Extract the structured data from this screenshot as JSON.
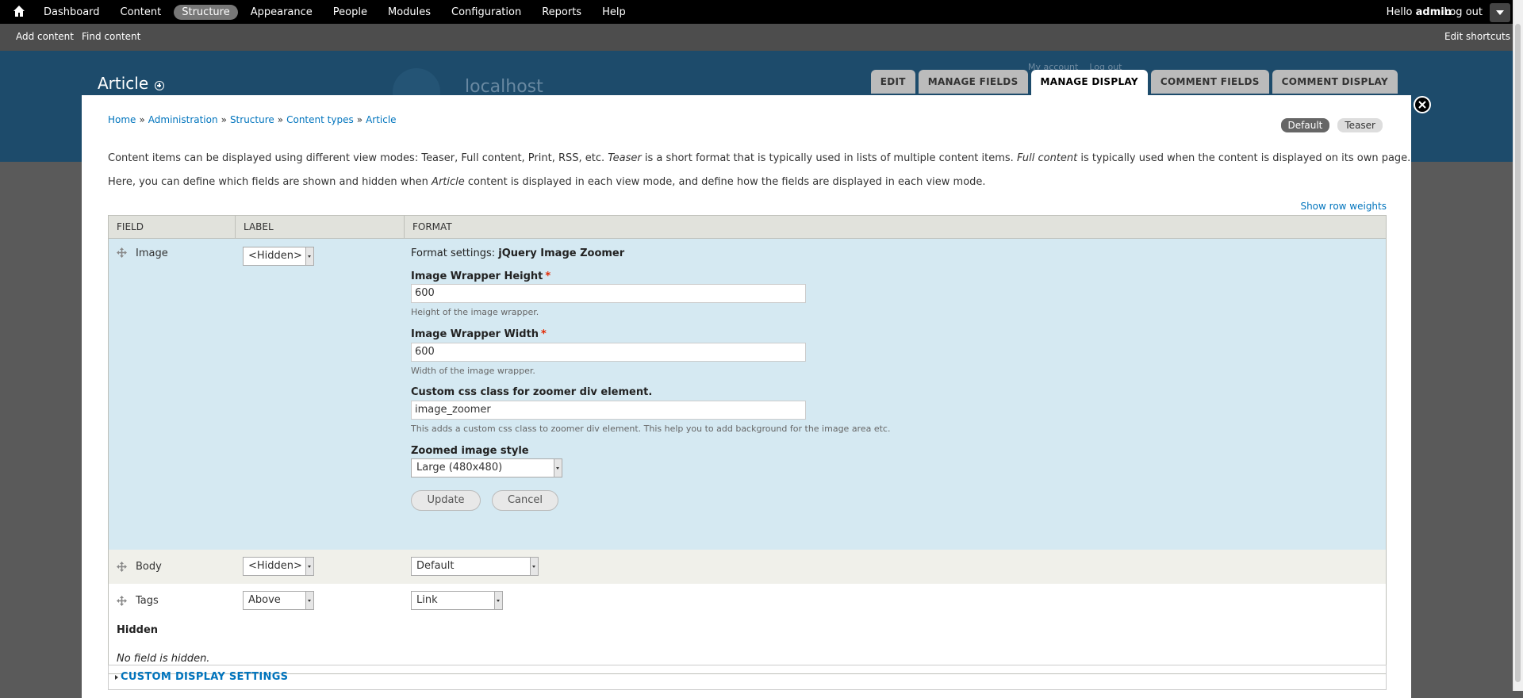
{
  "toolbar": {
    "menu": [
      "Dashboard",
      "Content",
      "Structure",
      "Appearance",
      "People",
      "Modules",
      "Configuration",
      "Reports",
      "Help"
    ],
    "active_item": "Structure",
    "hello": "Hello",
    "username": "admin",
    "logout": "Log out"
  },
  "shortcuts": {
    "add": "Add content",
    "find": "Find content",
    "edit": "Edit shortcuts"
  },
  "header": {
    "site_name": "localhost",
    "my_account": "My account",
    "log_out": "Log out"
  },
  "page": {
    "title": "Article"
  },
  "tabs": [
    "EDIT",
    "MANAGE FIELDS",
    "MANAGE DISPLAY",
    "COMMENT FIELDS",
    "COMMENT DISPLAY"
  ],
  "active_tab": "MANAGE DISPLAY",
  "breadcrumb": [
    "Home",
    "Administration",
    "Structure",
    "Content types",
    "Article"
  ],
  "view_modes": [
    "Default",
    "Teaser"
  ],
  "active_view_mode": "Default",
  "intro": {
    "line1_a": "Content items can be displayed using different view modes: Teaser, Full content, Print, RSS, etc. ",
    "line1_b": "Teaser",
    "line1_c": " is a short format that is typically used in lists of multiple content items. ",
    "line1_d": "Full content",
    "line1_e": " is typically used when the content is displayed on its own page.",
    "line2_a": "Here, you can define which fields are shown and hidden when ",
    "line2_b": "Article",
    "line2_c": " content is displayed in each view mode, and define how the fields are displayed in each view mode."
  },
  "show_row_weights": "Show row weights",
  "table": {
    "headers": {
      "field": "FIELD",
      "label": "LABEL",
      "format": "FORMAT"
    },
    "image_row": {
      "field": "Image",
      "label_select": "<Hidden>",
      "format_settings_prefix": "Format settings: ",
      "format_settings_name": "jQuery Image Zoomer",
      "height": {
        "label": "Image Wrapper Height",
        "required": "*",
        "value": "600",
        "help": "Height of the image wrapper."
      },
      "width": {
        "label": "Image Wrapper Width",
        "required": "*",
        "value": "600",
        "help": "Width of the image wrapper."
      },
      "css": {
        "label": "Custom css class for zoomer div element.",
        "value": "image_zoomer",
        "help": "This adds a custom css class to zoomer div element. This help you to add background for the image area etc."
      },
      "style": {
        "label": "Zoomed image style",
        "value": "Large (480x480)"
      },
      "update": "Update",
      "cancel": "Cancel"
    },
    "body_row": {
      "field": "Body",
      "label_select": "<Hidden>",
      "format_select": "Default"
    },
    "tags_row": {
      "field": "Tags",
      "label_select": "Above",
      "format_select": "Link"
    },
    "hidden_heading": "Hidden",
    "no_hidden": "No field is hidden."
  },
  "custom_display": "CUSTOM DISPLAY SETTINGS",
  "colors": {
    "link": "#0074bd",
    "header_bg": "#1d4b6b",
    "edit_row_bg": "#d5e9f2"
  }
}
